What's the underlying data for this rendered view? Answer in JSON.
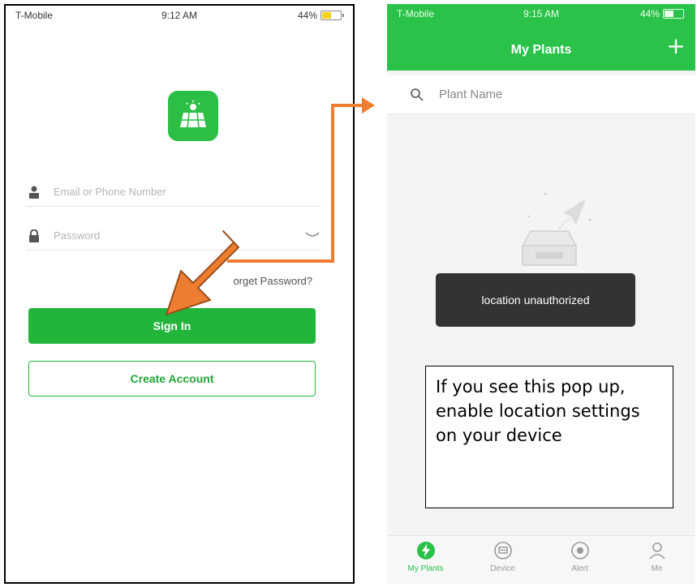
{
  "left_phone": {
    "status": {
      "carrier": "T-Mobile",
      "time": "9:12 AM",
      "battery": "44%"
    },
    "email_placeholder": "Email or Phone Number",
    "password_placeholder": "Password",
    "forgot_password": "orget Password?",
    "sign_in": "Sign In",
    "create_account": "Create Account"
  },
  "right_phone": {
    "status": {
      "carrier": "T-Mobile",
      "time": "9:15 AM",
      "battery": "44%"
    },
    "header_title": "My Plants",
    "add_label": "+",
    "search_placeholder": "Plant Name",
    "toast": "location unauthorized",
    "callout": "If you see this pop up, enable location settings on your device",
    "tabs": [
      {
        "label": "My Plants",
        "icon": "lightning-icon",
        "active": true
      },
      {
        "label": "Device",
        "icon": "device-icon",
        "active": false
      },
      {
        "label": "Alert",
        "icon": "alert-icon",
        "active": false
      },
      {
        "label": "Me",
        "icon": "user-icon",
        "active": false
      }
    ]
  },
  "colors": {
    "brand_green": "#2bc24a",
    "arrow_orange": "#ed7d31",
    "toast_bg": "#333333"
  }
}
